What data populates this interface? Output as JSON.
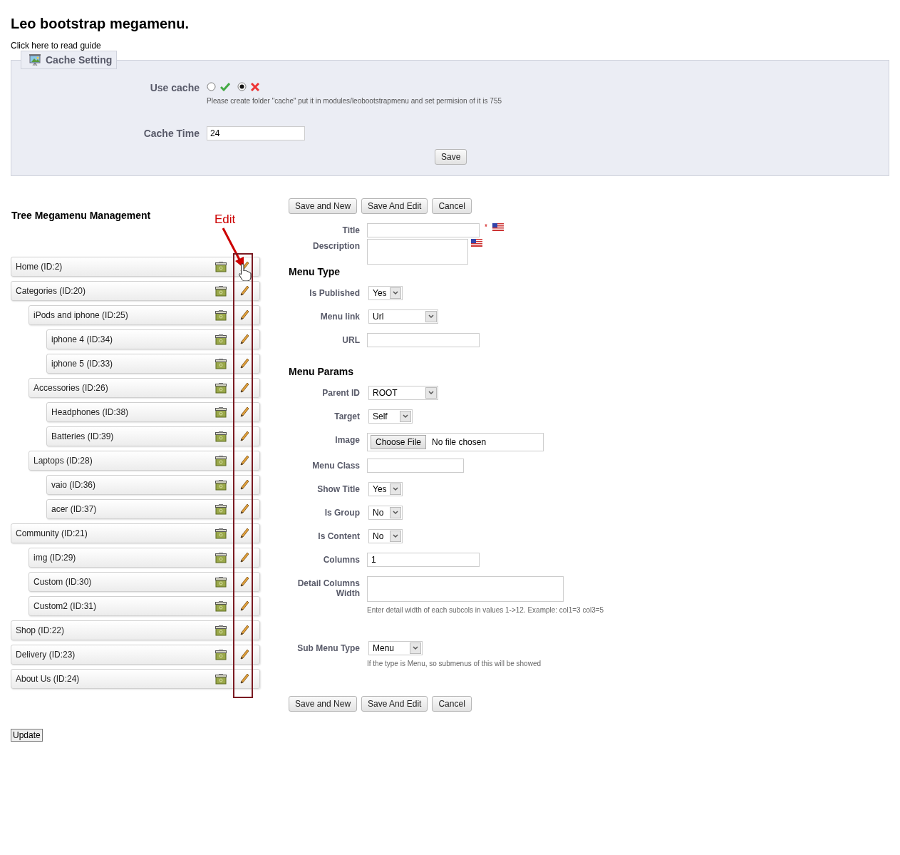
{
  "page": {
    "title": "Leo bootstrap megamenu.",
    "guide_link": "Click here to read guide"
  },
  "cache_setting": {
    "legend": "Cache Setting",
    "use_cache": {
      "label": "Use cache",
      "options": [
        {
          "kind": "check",
          "selected": false
        },
        {
          "kind": "cross",
          "selected": true
        }
      ],
      "help": "Please create folder \"cache\" put it in modules/leobootstrapmenu and set permision of it is 755"
    },
    "cache_time": {
      "label": "Cache Time",
      "value": "24"
    },
    "save_button": "Save"
  },
  "tree": {
    "heading": "Tree Megamenu Management",
    "annotation": "Edit",
    "items": [
      {
        "label": "Home (ID:2)"
      },
      {
        "label": "Categories (ID:20)",
        "children": [
          {
            "label": "iPods and iphone (ID:25)",
            "children": [
              {
                "label": "iphone 4 (ID:34)"
              },
              {
                "label": "iphone 5 (ID:33)"
              }
            ]
          },
          {
            "label": "Accessories (ID:26)",
            "children": [
              {
                "label": "Headphones (ID:38)"
              },
              {
                "label": "Batteries (ID:39)"
              }
            ]
          },
          {
            "label": "Laptops (ID:28)",
            "children": [
              {
                "label": "vaio (ID:36)"
              },
              {
                "label": "acer (ID:37)"
              }
            ]
          }
        ]
      },
      {
        "label": "Community (ID:21)",
        "children": [
          {
            "label": "img (ID:29)"
          },
          {
            "label": "Custom (ID:30)"
          },
          {
            "label": "Custom2 (ID:31)"
          }
        ]
      },
      {
        "label": "Shop (ID:22)"
      },
      {
        "label": "Delivery (ID:23)"
      },
      {
        "label": "About Us (ID:24)"
      }
    ],
    "update_button": "Update"
  },
  "form": {
    "buttons": [
      "Save and New",
      "Save And Edit",
      "Cancel"
    ],
    "sections": [
      {
        "fields": [
          {
            "kind": "text",
            "label": "Title",
            "required_mark": "*",
            "flag": true
          },
          {
            "kind": "textarea",
            "label": "Description",
            "flag": true
          }
        ]
      },
      {
        "heading": "Menu Type",
        "fields": [
          {
            "kind": "select",
            "label": "Is Published",
            "value": "Yes"
          },
          {
            "kind": "select",
            "label": "Menu link",
            "value": "Url"
          },
          {
            "kind": "text",
            "label": "URL"
          }
        ]
      },
      {
        "heading": "Menu Params",
        "fields": [
          {
            "kind": "select",
            "label": "Parent ID",
            "value": "ROOT"
          },
          {
            "kind": "select",
            "label": "Target",
            "value": "Self"
          },
          {
            "kind": "file",
            "label": "Image",
            "button": "Choose File",
            "value": "No file chosen"
          },
          {
            "kind": "text",
            "label": "Menu Class"
          },
          {
            "kind": "select",
            "label": "Show Title",
            "value": "Yes"
          },
          {
            "kind": "select",
            "label": "Is Group",
            "value": "No"
          },
          {
            "kind": "select",
            "label": "Is Content",
            "value": "No"
          },
          {
            "kind": "text",
            "label": "Columns",
            "value": "1"
          },
          {
            "kind": "textarea",
            "label": "Detail Columns Width",
            "help": "Enter detail width of each subcols in values 1->12. Example: col1=3 col3=5"
          },
          {
            "kind": "select",
            "label": "Sub Menu Type",
            "value": "Menu",
            "help": "If the type is Menu, so submenus of this will be showed"
          }
        ]
      }
    ],
    "bottom_buttons": [
      "Save and New",
      "Save And Edit",
      "Cancel"
    ]
  }
}
